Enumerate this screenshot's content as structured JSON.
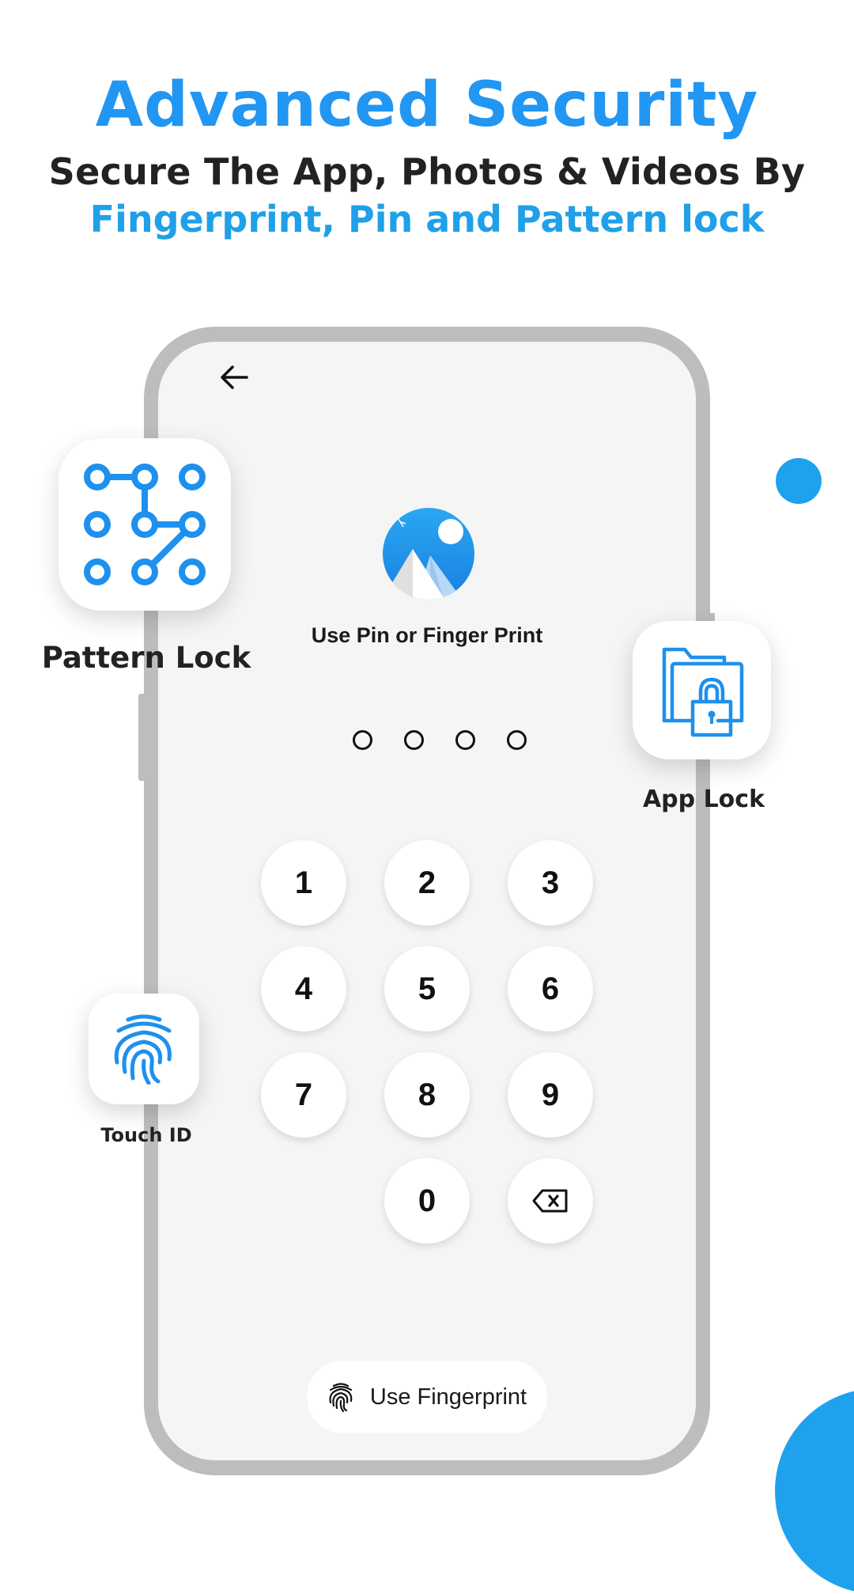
{
  "header": {
    "title": "Advanced Security",
    "subtitle_line1": "Secure The App, Photos & Videos By",
    "subtitle_line2": "Fingerprint, Pin and Pattern lock"
  },
  "colors": {
    "accent": "#2196f3",
    "accent_secondary": "#1fa2ee",
    "text_dark": "#222222",
    "phone_frame": "#bdbdbd",
    "screen_bg": "#f5f5f5"
  },
  "phone_screen": {
    "back_icon": "arrow-left-icon",
    "logo_icon": "gallery-mountain-icon",
    "prompt": "Use Pin or Finger Print",
    "pin_length": 4,
    "pin_entered": 0,
    "keypad": {
      "keys": [
        "1",
        "2",
        "3",
        "4",
        "5",
        "6",
        "7",
        "8",
        "9",
        "0"
      ],
      "backspace_icon": "backspace-icon"
    },
    "fingerprint_button": {
      "icon": "fingerprint-icon",
      "label": "Use Fingerprint"
    }
  },
  "features": [
    {
      "label": "Pattern Lock",
      "icon": "pattern-lock-icon"
    },
    {
      "label": "App Lock",
      "icon": "folder-lock-icon"
    },
    {
      "label": "Touch ID",
      "icon": "fingerprint-icon"
    }
  ]
}
